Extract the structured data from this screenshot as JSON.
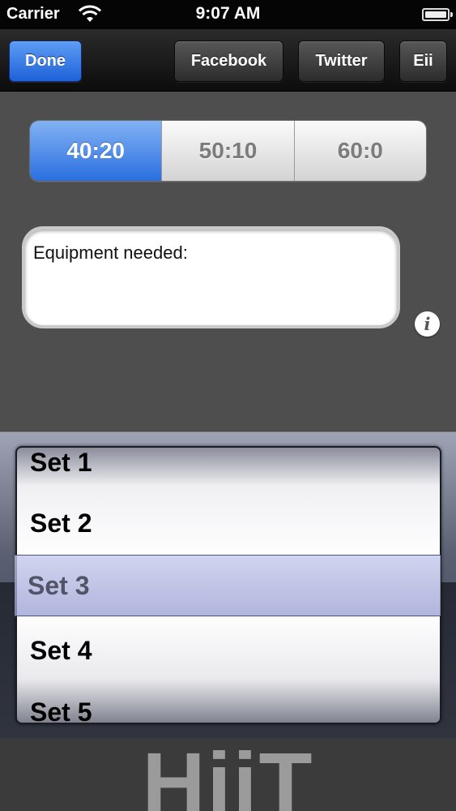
{
  "status_bar": {
    "carrier": "Carrier",
    "time": "9:07 AM"
  },
  "toolbar": {
    "done_label": "Done",
    "facebook_label": "Facebook",
    "twitter_label": "Twitter",
    "eii_label": "Eii"
  },
  "ratio_selector": {
    "options": [
      "40:20",
      "50:10",
      "60:0"
    ],
    "selected": "40:20"
  },
  "equipment": {
    "text": "Equipment needed:"
  },
  "info_button": {
    "glyph": "i"
  },
  "picker": {
    "items": [
      "Set 1",
      "Set 2",
      "Set 3",
      "Set 4",
      "Set 5"
    ],
    "selected": "Set 3"
  },
  "logo": {
    "text": "HiiT"
  },
  "colors": {
    "accent_blue": "#2a6fe0",
    "background": "#4e4e4e"
  }
}
